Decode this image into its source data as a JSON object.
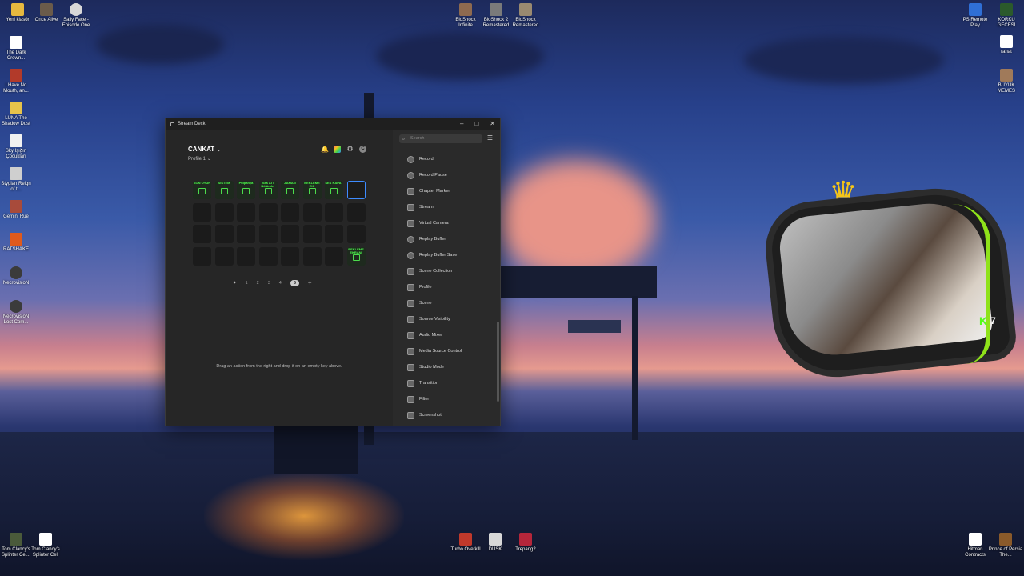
{
  "desktop": {
    "top_icons": [
      {
        "label": "Yeni klasör"
      },
      {
        "label": "Once Alive"
      },
      {
        "label": "Sally Face - Episode One"
      },
      {
        "label": "BioShock Infinite"
      },
      {
        "label": "BioShock 2 Remastered"
      },
      {
        "label": "BioShock Remastered"
      },
      {
        "label": "PS Remote Play"
      },
      {
        "label": "KORKU GECESİ"
      }
    ],
    "left_icons": [
      {
        "label": "The Dark Crown..."
      },
      {
        "label": "I Have No Mouth, an..."
      },
      {
        "label": "LUNA The Shadow Dust"
      },
      {
        "label": "Sky Işığın Çocukları"
      },
      {
        "label": "Stygian Reign of t..."
      },
      {
        "label": "Gemini Rue"
      },
      {
        "label": "RATSHAKE"
      },
      {
        "label": "NecrovisioN"
      },
      {
        "label": "NecrovisioN Lost Com..."
      }
    ],
    "right_icons": [
      {
        "label": "rahat"
      },
      {
        "label": "BÜYÜK MEMES"
      }
    ],
    "bottom_icons": [
      {
        "label": "Tom Clancy's Splinter Cel..."
      },
      {
        "label": "Tom Clancy's Splinter Cell"
      },
      {
        "label": "Turbo Overkill"
      },
      {
        "label": "DUSK"
      },
      {
        "label": "Trepang2"
      },
      {
        "label": "Hitman Contracts"
      },
      {
        "label": "Prince of Persia The..."
      }
    ]
  },
  "window": {
    "title": "Stream Deck",
    "minimize": "–",
    "maximize": "□",
    "close": "✕"
  },
  "profile": {
    "name": "CANKAT",
    "name_chevron": "⌄",
    "sub": "Profile 1",
    "sub_chevron": "⌄",
    "avatar_letter": "C"
  },
  "keys_row1": [
    "SON OYUN",
    "SİSTEM",
    "Pulpanya",
    "Ses Al / Bölümler",
    "ZAMAN",
    "BEKLEME EK.",
    "SES KAPAT",
    ""
  ],
  "key_last": "BEKLEME EKRANI",
  "pager": {
    "pages": [
      "1",
      "2",
      "3",
      "4",
      "5"
    ],
    "current": "5",
    "add": "+"
  },
  "hint": "Drag an action from the right and drop it on an empty key above.",
  "search": {
    "placeholder": "Search"
  },
  "actions": [
    "Record",
    "Record Pause",
    "Chapter Marker",
    "Stream",
    "Virtual Camera",
    "Replay Buffer",
    "Replay Buffer Save",
    "Scene Collection",
    "Profile",
    "Scene",
    "Source Visibility",
    "Audio Mixer",
    "Media Source Control",
    "Studio Mode",
    "Transition",
    "Filter",
    "Screenshot"
  ],
  "overlay": {
    "kick_count": "7"
  }
}
